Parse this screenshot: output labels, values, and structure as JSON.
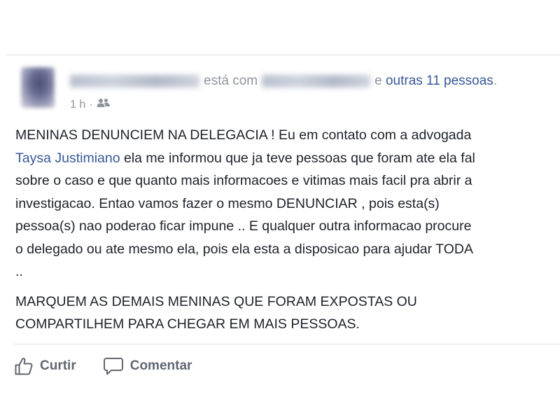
{
  "post": {
    "header": {
      "connector": "está com",
      "conjunction": "e",
      "others": "outras 11 pessoas",
      "period": "."
    },
    "time": "1 h",
    "privacy_icon": "friends-icon",
    "body": {
      "line1": "MENINAS DENUNCIEM NA DELEGACIA ! Eu em contato com a advogada",
      "mention": "Taysa Justimiano",
      "line2_rest": " ela me informou que ja teve pessoas que foram ate ela fal",
      "line3": "sobre o caso e que quanto mais informacoes e vitimas mais facil pra abrir a",
      "line4": "investigacao. Entao vamos fazer o mesmo DENUNCIAR , pois esta(s)",
      "line5": "pessoa(s) nao poderao ficar impune .. E qualquer outra informacao procure",
      "line6": "o delegado ou ate mesmo ela, pois ela esta a disposicao para ajudar TODA",
      "line7": "..",
      "line8": "MARQUEM AS DEMAIS MENINAS QUE FORAM EXPOSTAS OU",
      "line9": "COMPARTILHEM PARA CHEGAR EM MAIS PESSOAS."
    },
    "actions": {
      "like_label": "Curtir",
      "like_icon": "thumbs-up-icon",
      "comment_label": "Comentar",
      "comment_icon": "comment-icon"
    }
  },
  "colors": {
    "link": "#365899",
    "muted": "#90949c",
    "text": "#1d2129",
    "action": "#606770"
  }
}
